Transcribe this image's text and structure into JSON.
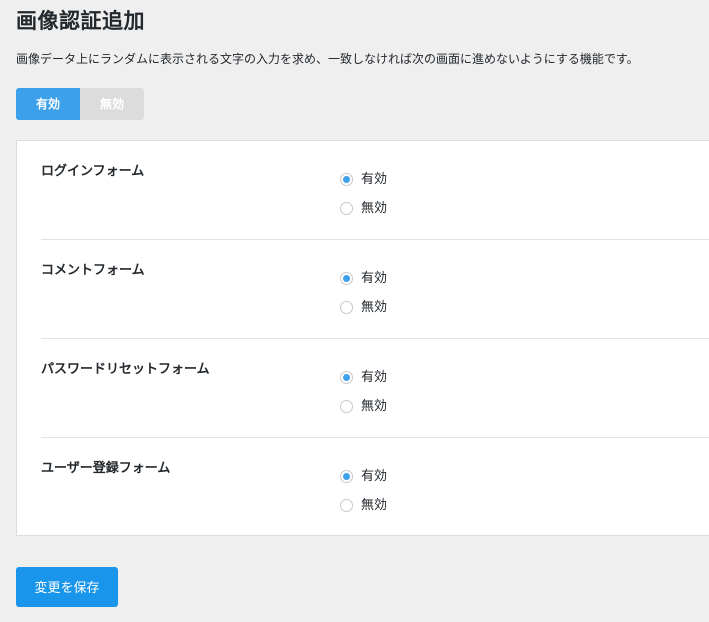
{
  "page": {
    "title": "画像認証追加",
    "description": "画像データ上にランダムに表示される文字の入力を求め、一致しなければ次の画面に進めないようにする機能です。"
  },
  "toggle": {
    "on_label": "有効",
    "off_label": "無効",
    "selected": "on"
  },
  "forms": [
    {
      "label": "ログインフォーム",
      "enabled_label": "有効",
      "disabled_label": "無効",
      "selected": "enabled"
    },
    {
      "label": "コメントフォーム",
      "enabled_label": "有効",
      "disabled_label": "無効",
      "selected": "enabled"
    },
    {
      "label": "パスワードリセットフォーム",
      "enabled_label": "有効",
      "disabled_label": "無効",
      "selected": "enabled"
    },
    {
      "label": "ユーザー登録フォーム",
      "enabled_label": "有効",
      "disabled_label": "無効",
      "selected": "enabled"
    }
  ],
  "actions": {
    "save_label": "変更を保存"
  },
  "colors": {
    "accent": "#3da0ea",
    "button": "#1a95ec",
    "background": "#efefef"
  }
}
